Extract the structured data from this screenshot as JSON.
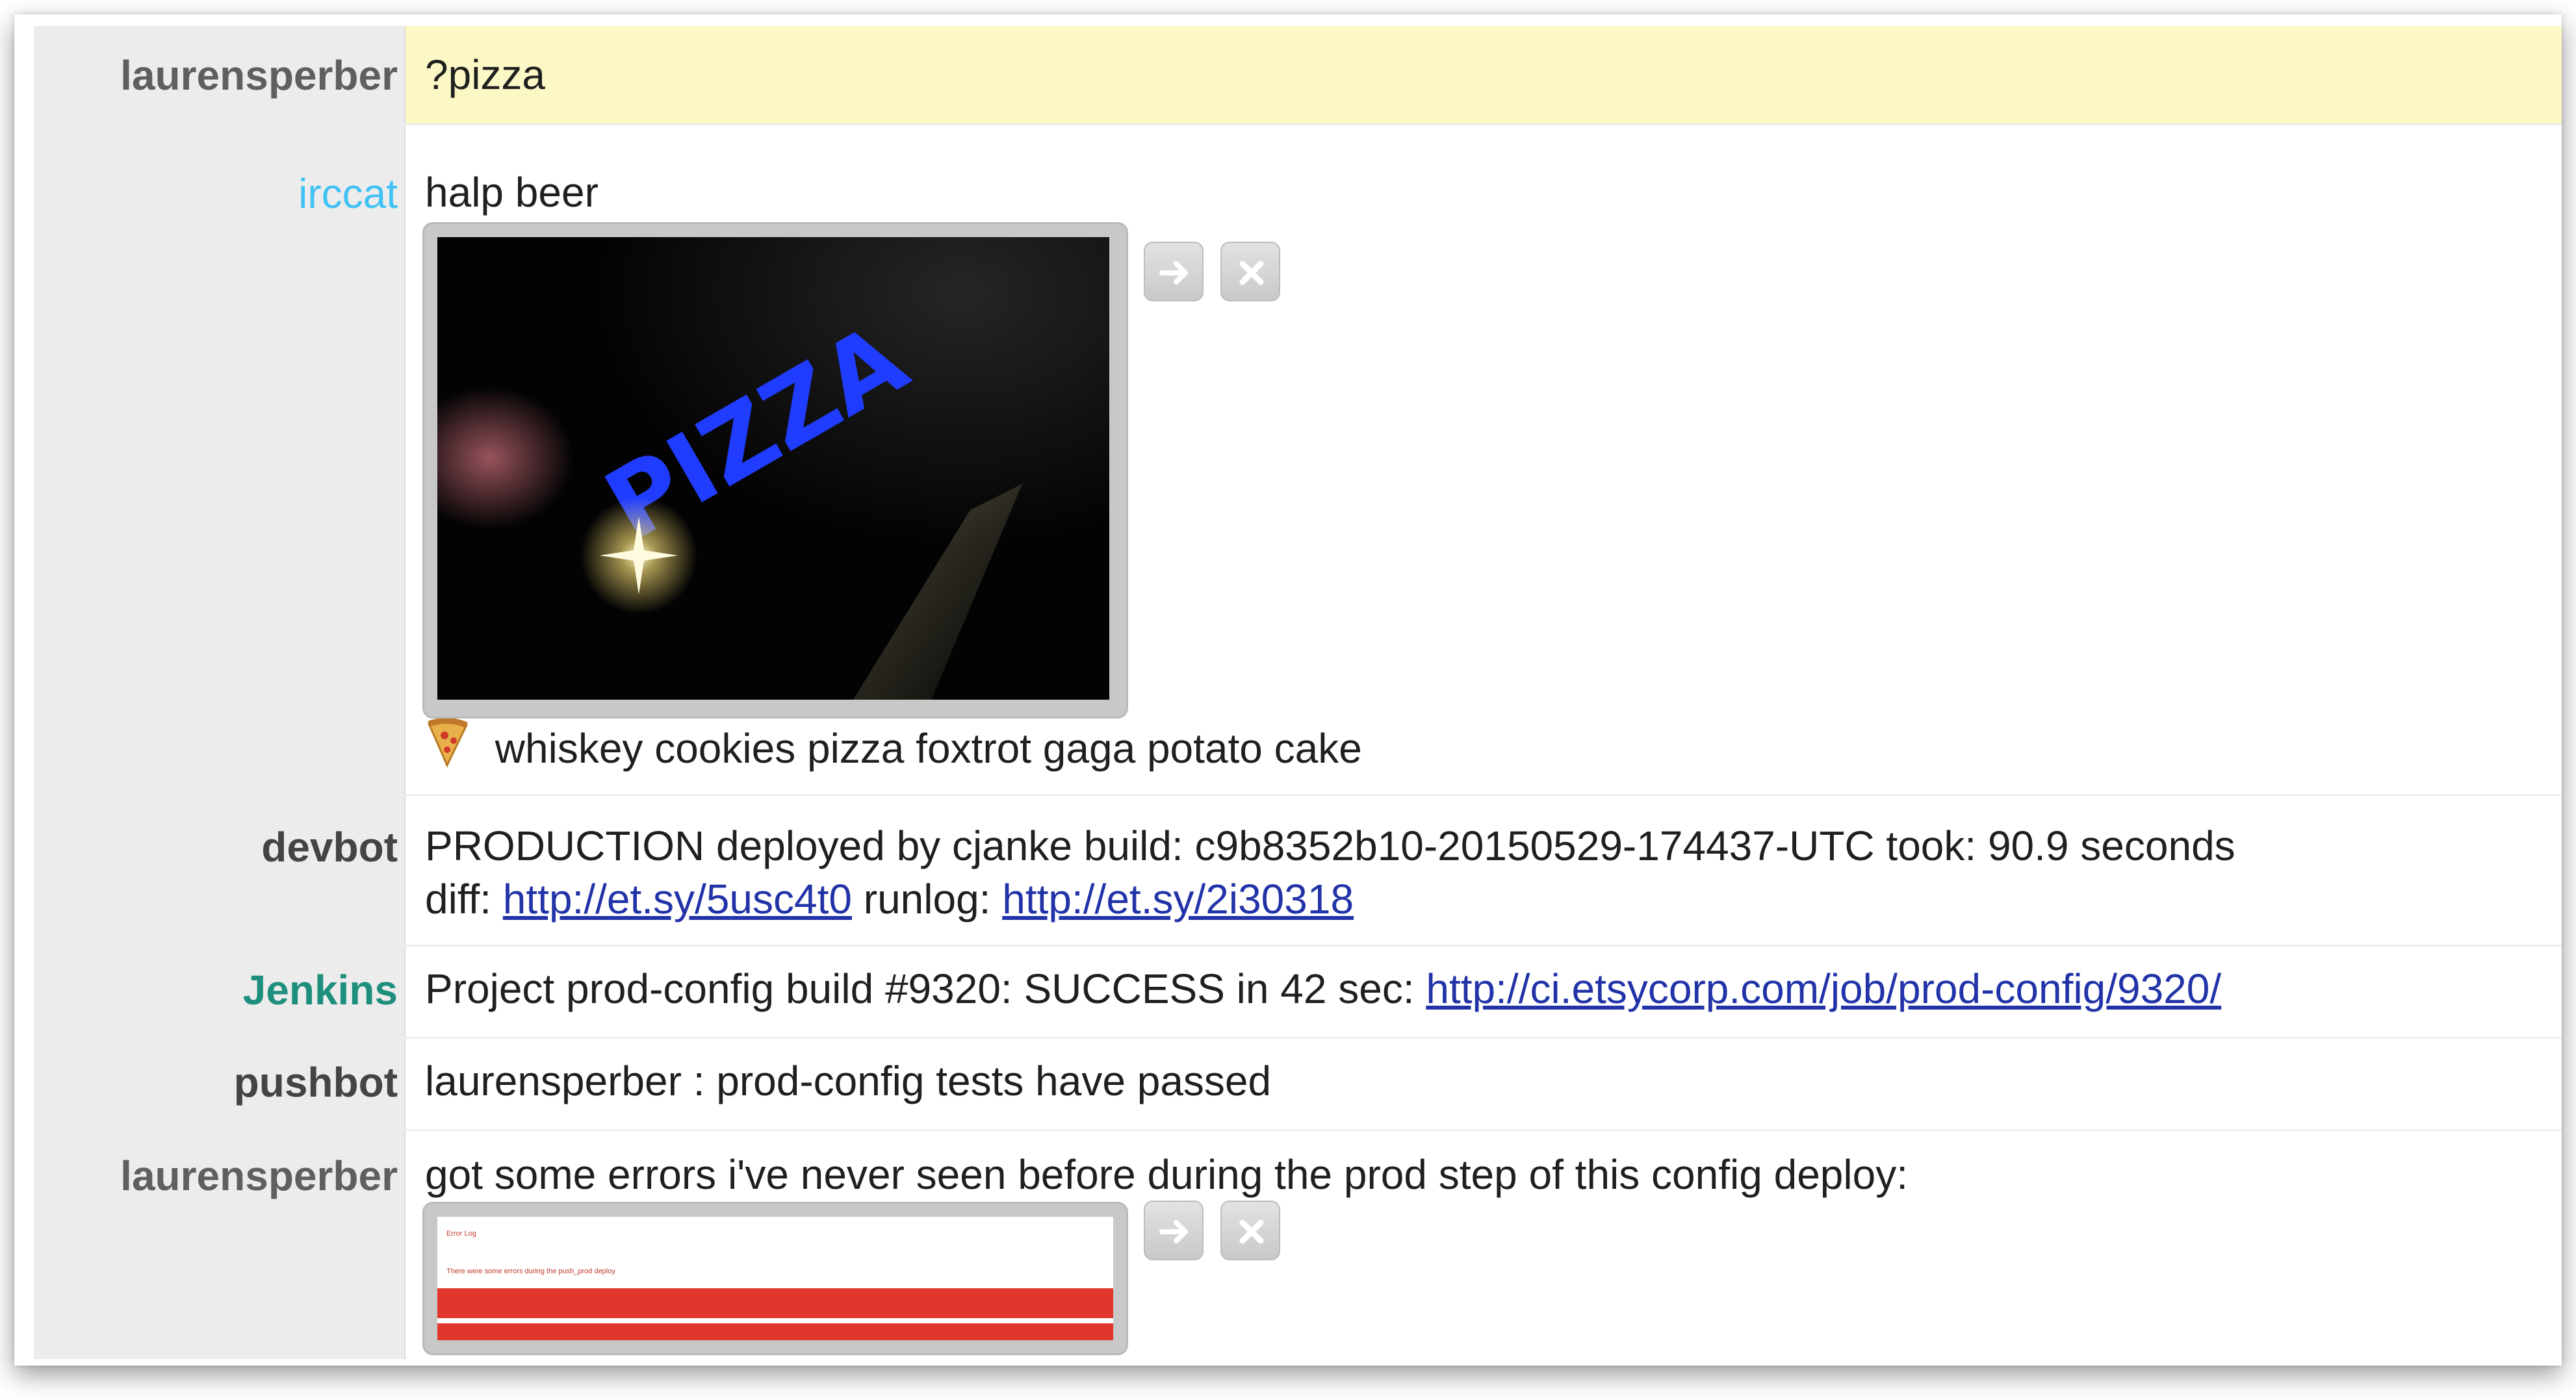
{
  "messages": [
    {
      "nick": "laurensperber",
      "text": "?pizza"
    },
    {
      "nick": "irccat",
      "text": "halp beer",
      "image_word": "PIZZA",
      "caption": "whiskey cookies pizza foxtrot gaga potato cake",
      "caption_icon": "pizza-slice-icon"
    },
    {
      "nick": "devbot",
      "line1": "PRODUCTION deployed by cjanke build: c9b8352b10-20150529-174437-UTC took: 90.9 seconds",
      "diff_label": "diff: ",
      "diff_url": "http://et.sy/5usc4t0",
      "runlog_label": " runlog: ",
      "runlog_url": "http://et.sy/2i30318"
    },
    {
      "nick": "Jenkins",
      "text": "Project prod-config build #9320: SUCCESS in 42 sec: ",
      "url": "http://ci.etsycorp.com/job/prod-config/9320/"
    },
    {
      "nick": "pushbot",
      "text": "laurensperber : prod-config tests have passed"
    },
    {
      "nick": "laurensperber",
      "text": "got some errors i've never seen before during the prod step of this config deploy:",
      "image_title": "Error Log",
      "image_subtitle": "There were some errors during the push_prod deploy"
    }
  ],
  "icons": {
    "open": "arrow-right-icon",
    "close": "close-x-icon"
  },
  "colors": {
    "highlight": "#fcf8c6",
    "nick_irccat": "#41c2f5",
    "nick_jenkins": "#1e8f7d",
    "link": "#2233a8",
    "error_red": "#e0362c"
  }
}
